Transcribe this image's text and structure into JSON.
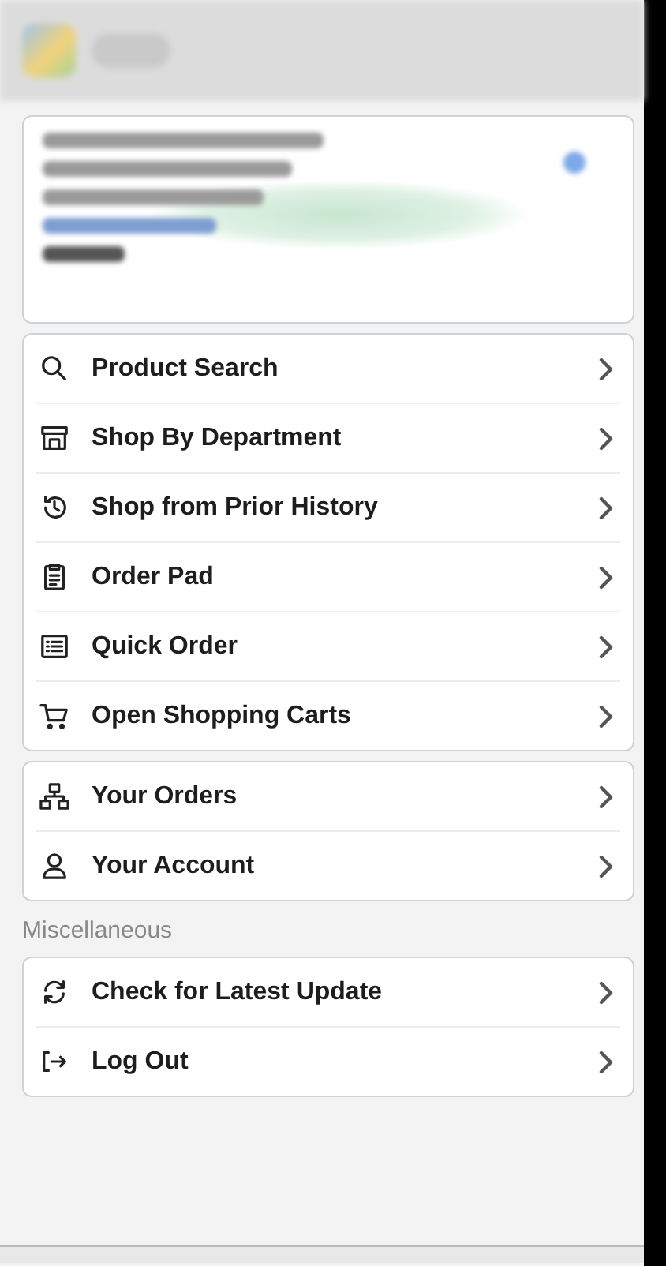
{
  "sections": [
    {
      "items": [
        {
          "kind": "search",
          "label": "Product Search"
        },
        {
          "kind": "store",
          "label": "Shop By Department"
        },
        {
          "kind": "history",
          "label": "Shop from Prior History"
        },
        {
          "kind": "clipboard",
          "label": "Order Pad"
        },
        {
          "kind": "list",
          "label": "Quick Order"
        },
        {
          "kind": "cart",
          "label": "Open Shopping Carts"
        }
      ]
    },
    {
      "items": [
        {
          "kind": "orders",
          "label": "Your Orders"
        },
        {
          "kind": "account",
          "label": "Your Account"
        }
      ]
    },
    {
      "heading": "Miscellaneous",
      "items": [
        {
          "kind": "update",
          "label": "Check for Latest Update"
        },
        {
          "kind": "logout",
          "label": "Log Out"
        }
      ]
    }
  ]
}
